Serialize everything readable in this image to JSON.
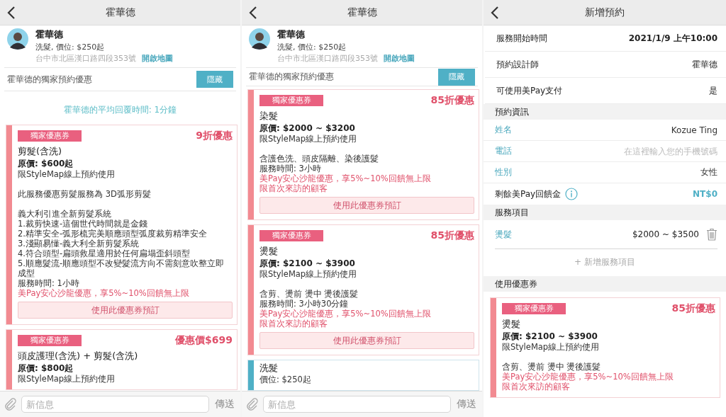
{
  "panels": [
    {
      "kind": "chat",
      "title": "霍華德",
      "profile": {
        "name": "霍華德",
        "service": "洗髮, 價位: $250起",
        "address": "台中市北區漢口路四段353號",
        "map_link": "開啟地圖"
      },
      "offers_header": {
        "label": "霍華德的獨家預約優惠",
        "button": "隱藏"
      },
      "reply_time": "霍華德的平均回覆時間: 1分鐘",
      "cards": [
        {
          "kind": "coupon",
          "tag": "獨家優惠券",
          "discount": "9折優惠",
          "title": "剪髮(含洗)",
          "price": "原價: $600起",
          "paragraphs": [
            [
              "限StyleMap線上預約使用"
            ],
            [
              "此服務優惠剪髮服務為 3D弧形剪髮"
            ],
            [
              "義大利引進全新剪髮系統",
              "1.裁剪快速-這個世代時間就是金錢",
              "2.精準安全-弧形梳完美順應頭型弧度裁剪精準安全",
              "3.淺顯易懂-義大利全新剪髮系統",
              "4.符合頭型-扁頭救星適用於任何扁塌歪斜頭型",
              "5.順應髮流-順應頭型不改變髮流方向不需刻意吹整立即成型",
              "服務時間: 1小時"
            ]
          ],
          "promos": [
            "美Pay安心沙龍優惠，享5%~10%回饋無上限"
          ],
          "button": "使用此優惠券預訂"
        },
        {
          "kind": "coupon",
          "tag": "獨家優惠券",
          "discount": "優惠價$699",
          "title": "頭皮護理(含洗) + 剪髮(含洗)",
          "price": "原價: $800起",
          "paragraphs": [
            [
              "限StyleMap線上預約使用"
            ]
          ]
        }
      ],
      "composer": {
        "placeholder": "新信息",
        "send": "傳送"
      }
    },
    {
      "kind": "chat",
      "title": "霍華德",
      "profile": {
        "name": "霍華德",
        "service": "洗髮, 價位: $250起",
        "address": "台中市北區漢口路四段353號",
        "map_link": "開啟地圖"
      },
      "offers_header": {
        "label": "霍華德的獨家預約優惠",
        "button": "隱藏"
      },
      "cards": [
        {
          "kind": "coupon",
          "tag": "獨家優惠券",
          "discount": "85折優惠",
          "title": "染髮",
          "price": "原價: $2000 ~ $3200",
          "paragraphs": [
            [
              "限StyleMap線上預約使用"
            ],
            [
              "含護色洗、頭皮隔離、染後護髮",
              "服務時間: 3小時"
            ]
          ],
          "promos": [
            "美Pay安心沙龍優惠，享5%~10%回饋無上限",
            "限首次來訪的顧客"
          ],
          "button": "使用此優惠券預訂"
        },
        {
          "kind": "coupon",
          "tag": "獨家優惠券",
          "discount": "85折優惠",
          "title": "燙髮",
          "price": "原價: $2100 ~ $3900",
          "paragraphs": [
            [
              "限StyleMap線上預約使用"
            ],
            [
              "含剪、燙前 燙中 燙後護髮",
              "服務時間: 3小時30分鐘"
            ]
          ],
          "promos": [
            "美Pay安心沙龍優惠，享5%~10%回饋無上限",
            "限首次來訪的顧客"
          ],
          "button": "使用此優惠券預訂"
        },
        {
          "kind": "service",
          "title": "洗髮",
          "price": "價位: $250起"
        }
      ],
      "composer": {
        "placeholder": "新信息",
        "send": "傳送"
      }
    },
    {
      "kind": "booking",
      "title": "新增預約",
      "sections": [
        {
          "kind": "rows",
          "rows": [
            {
              "label": "服務開始時間",
              "value": "2021/1/9 上午10:00"
            },
            {
              "label": "預約設計師",
              "value": "霍華德"
            },
            {
              "label": "可使用美Pay支付",
              "value": "是"
            }
          ]
        },
        {
          "kind": "form",
          "heading": "預約資訊",
          "fields": [
            {
              "label": "姓名",
              "value": "Kozue Ting"
            },
            {
              "label": "電話",
              "placeholder": "在這裡輸入您的手機號碼"
            },
            {
              "label": "性別",
              "value": "女性"
            }
          ]
        },
        {
          "kind": "balance",
          "label": "剩餘美Pay回饋金",
          "value": "NT$0"
        },
        {
          "kind": "services",
          "heading": "服務項目",
          "items": [
            {
              "name": "燙髮",
              "price": "$2000 ~ $3500"
            }
          ],
          "add": "+ 新增服務項目"
        },
        {
          "kind": "coupons",
          "heading": "使用優惠券",
          "cards": [
            {
              "kind": "coupon",
              "tag": "獨家優惠券",
              "discount": "85折優惠",
              "title": "燙髮",
              "price": "原價: $2100 ~ $3900",
              "paragraphs": [
                [
                  "限StyleMap線上預約使用"
                ],
                [
                  "含剪、燙前 燙中 燙後護髮"
                ]
              ],
              "promos": [
                "美Pay安心沙龍優惠，享5%~10%回饋無上限",
                "限首次來訪的顧客"
              ]
            }
          ]
        }
      ]
    }
  ]
}
